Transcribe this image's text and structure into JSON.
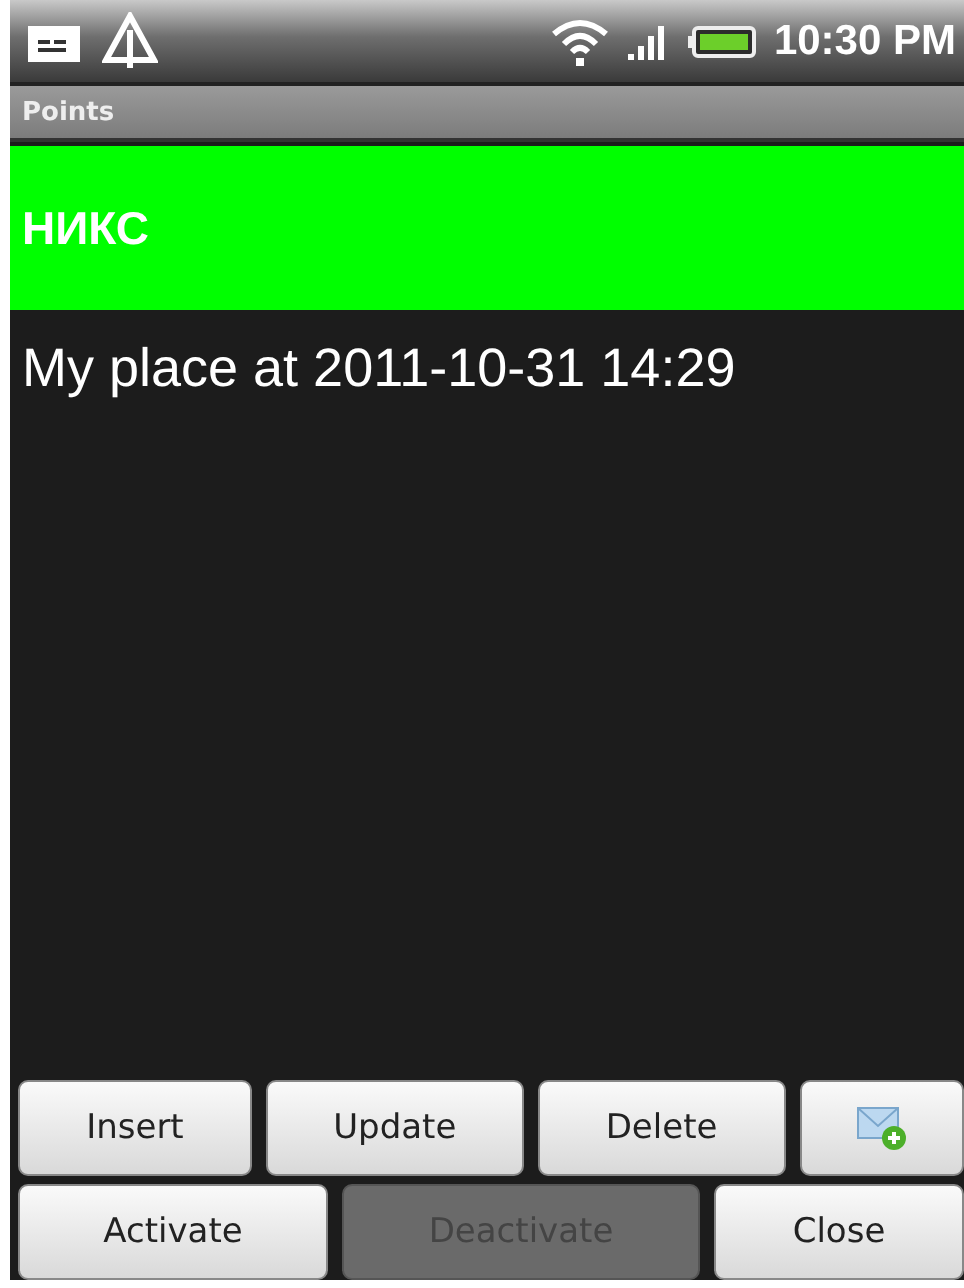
{
  "status_bar": {
    "time": "10:30 PM"
  },
  "window": {
    "title": "Points"
  },
  "header": {
    "title": "НИКС"
  },
  "points": [
    {
      "label": "My place at 2011-10-31 14:29"
    }
  ],
  "button_rows": [
    [
      {
        "kind": "text",
        "label": "Insert",
        "disabled": false
      },
      {
        "kind": "text",
        "label": "Update",
        "disabled": false
      },
      {
        "kind": "text",
        "label": "Delete",
        "disabled": false
      },
      {
        "kind": "icon",
        "disabled": false
      }
    ],
    [
      {
        "kind": "text",
        "label": "Activate",
        "disabled": false
      },
      {
        "kind": "text",
        "label": "Deactivate",
        "disabled": true
      },
      {
        "kind": "text",
        "label": "Close",
        "disabled": false
      }
    ]
  ]
}
